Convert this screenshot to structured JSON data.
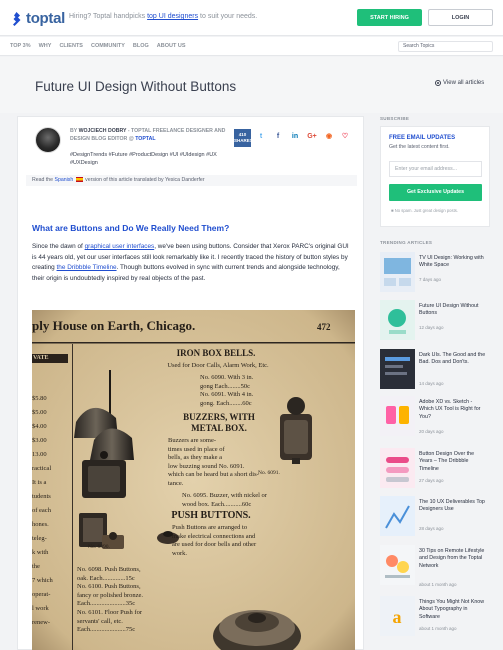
{
  "header": {
    "logo_text": "toptal",
    "hiring_prefix": "Hiring? Toptal handpicks",
    "hiring_link": "top UI designers",
    "hiring_suffix": "to suit your needs.",
    "start_hiring_label": "START HIRING",
    "login_label": "LOGIN"
  },
  "nav": {
    "items": [
      "TOP 3%",
      "WHY",
      "CLIENTS",
      "COMMUNITY",
      "BLOG",
      "ABOUT US"
    ],
    "search_placeholder": "Search Topics"
  },
  "article": {
    "title": "Future UI Design Without Buttons",
    "view_all": "View all articles",
    "by": "BY",
    "author_name": "WOJCIECH DOBRY",
    "author_role": "- TOPTAL FREELANCE DESIGNER AND DESIGN BLOG EDITOR @",
    "author_link": "TOPTAL",
    "tags": "#DesignTrends #Future #ProductDesign #UI #UIdesign #UX #UXDesign",
    "share_count": "410",
    "share_label": "SHARES",
    "translated_prefix": "Read the",
    "translated_link": "Spanish",
    "translated_suffix": "version of this article translated by Yesica Danderfer",
    "heading": "What are Buttons and Do We Really Need Them?",
    "para_1": "Since the dawn of",
    "para_link_1": "graphical user interfaces",
    "para_2": ", we've been using buttons. Consider that Xerox PARC's original GUI is 44 years old, yet our user interfaces still look remarkably like it. I recently traced the history of button styles by creating",
    "para_link_2": "the Dribbble Timeline",
    "para_3": ". Though buttons evolved in sync with current trends and alongside technology, their origin is undoubtedly inspired by real objects of the past.",
    "image": {
      "header": "ply House on Earth, Chicago.",
      "page_no": "472",
      "left_label": "VATE",
      "iron_title": "IRON BOX BELLS.",
      "iron_sub": "Used for Door Calls, Alarm Work, Etc.",
      "iron_l1": "No. 6090. With 3 in.",
      "iron_l2": "gong Each........50c",
      "iron_l3": "No. 6091. With 4 in.",
      "iron_l4": "gong. Each........60c",
      "buzz_title": "BUZZERS, WITH",
      "buzz_title2": "METAL BOX.",
      "buzz_l1": "Buzzers are some-",
      "buzz_l2": "times used in place of",
      "buzz_l3": "bells, as they make a",
      "buzz_l4": "low buzzing sound No. 6091.",
      "buzz_l5": "which can be heard but a short dis-",
      "buzz_l6": "tance.",
      "buzz_l7": "No. 6095. Buzzer, with nickel or",
      "buzz_l8": "wood box. Each...........60c",
      "push_title": "PUSH BUTTONS.",
      "push_l1": "Push Buttons are arranged to",
      "push_l2": "make electrical connections and",
      "push_l3": "are used for door bells and other",
      "push_l4": "work.",
      "push_l5": "No. 6098. Push Buttons,",
      "push_l6": "oak. Each..............15c",
      "push_l7": "No. 6100. Push Buttons,",
      "push_l8": "fancy or polished bronze.",
      "push_l9": "Each......................35c",
      "push_l10": "No. 6101. Floor Push for",
      "push_l11": "servants' call, etc.",
      "push_l12": "Each......................75c",
      "item_a": "No. 6090.",
      "item_b": "No. 6091.",
      "left_col": [
        "$5.80",
        "$5.00",
        "$4.00",
        "$3.00",
        "13.00",
        "ractical",
        "It is a",
        "tudents",
        "of each",
        "hones.",
        "teleg-",
        "k with",
        "the",
        "7 which",
        "operat-",
        "l work",
        "renew-"
      ]
    }
  },
  "sidebar": {
    "subscribe_label": "SUBSCRIBE",
    "free_email": "FREE EMAIL UPDATES",
    "latest": "Get the latest content first.",
    "email_placeholder": "Enter your email address...",
    "exclusive_label": "Get Exclusive Updates",
    "nospam": "No spam. Just great design posts.",
    "trending_label": "TRENDING ARTICLES",
    "trending": [
      {
        "title": "TV UI Design: Working with White Space",
        "date": "7 days ago"
      },
      {
        "title": "Future UI Design Without Buttons",
        "date": "12 days ago"
      },
      {
        "title": "Dark UIs. The Good and the Bad. Dos and Don'ts.",
        "date": "14 days ago"
      },
      {
        "title": "Adobe XD vs. Sketch - Which UX Tool is Right for You?",
        "date": "20 days ago"
      },
      {
        "title": "Button Design Over the Years – The Dribbble Timeline",
        "date": "27 days ago"
      },
      {
        "title": "The 10 UX Deliverables Top Designers Use",
        "date": "28 days ago"
      },
      {
        "title": "30 Tips on Remote Lifestyle and Design from the Toptal Network",
        "date": "about 1 month ago"
      },
      {
        "title": "Things You Might Not Know About Typography in Software",
        "date": "about 1 month ago"
      }
    ]
  }
}
